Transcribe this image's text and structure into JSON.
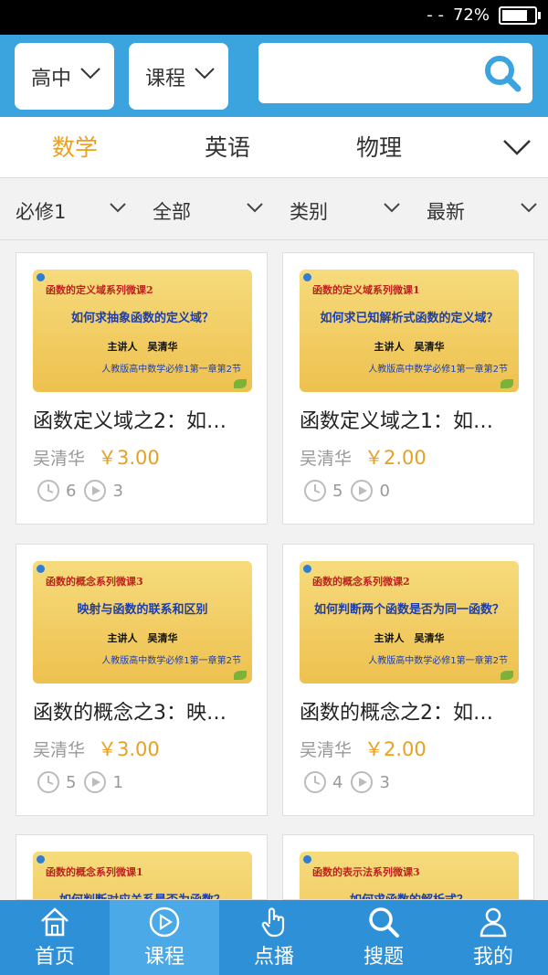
{
  "status_bar": {
    "signal": "- -",
    "battery_text": "72%",
    "battery_level": 0.72
  },
  "header": {
    "level_select": "高中",
    "type_select": "课程",
    "search": {
      "value": "",
      "placeholder": ""
    },
    "accent_color": "#3ba3dd"
  },
  "subjects": {
    "items": [
      "数学",
      "英语",
      "物理"
    ],
    "active": "数学"
  },
  "filters": [
    "必修1",
    "全部",
    "类别",
    "最新"
  ],
  "courses": [
    {
      "series": "函数的定义域系列微课2",
      "title": "如何求抽象函数的定义域？",
      "lecturer": "主讲人　吴清华",
      "book": "人教版高中数学必修1第一章第2节",
      "name": "函数定义域之2：如…",
      "author": "吴清华",
      "price": "￥3.00",
      "duration": "6",
      "plays": "3"
    },
    {
      "series": "函数的定义域系列微课1",
      "title": "如何求已知解析式函数的定义域？",
      "lecturer": "主讲人　吴清华",
      "book": "人教版高中数学必修1第一章第2节",
      "name": "函数定义域之1：如…",
      "author": "吴清华",
      "price": "￥2.00",
      "duration": "5",
      "plays": "0"
    },
    {
      "series": "函数的概念系列微课3",
      "title": "映射与函数的联系和区别",
      "lecturer": "主讲人　吴清华",
      "book": "人教版高中数学必修1第一章第2节",
      "name": "函数的概念之3：映…",
      "author": "吴清华",
      "price": "￥3.00",
      "duration": "5",
      "plays": "1"
    },
    {
      "series": "函数的概念系列微课2",
      "title": "如何判断两个函数是否为同一函数？",
      "lecturer": "主讲人　吴清华",
      "book": "人教版高中数学必修1第一章第2节",
      "name": "函数的概念之2：如…",
      "author": "吴清华",
      "price": "￥2.00",
      "duration": "4",
      "plays": "3"
    },
    {
      "series": "函数的概念系列微课1",
      "title": "如何判断对应关系是否为函数？",
      "lecturer": "",
      "book": "",
      "name": "",
      "author": "",
      "price": "",
      "duration": "",
      "plays": ""
    },
    {
      "series": "函数的表示法系列微课3",
      "title": "如何求函数的解析式？",
      "lecturer": "",
      "book": "",
      "name": "",
      "author": "",
      "price": "",
      "duration": "",
      "plays": ""
    }
  ],
  "tabbar": {
    "items": [
      {
        "label": "首页",
        "icon": "home-icon"
      },
      {
        "label": "课程",
        "icon": "play-circle-icon"
      },
      {
        "label": "点播",
        "icon": "hand-pointer-icon"
      },
      {
        "label": "搜题",
        "icon": "search-icon"
      },
      {
        "label": "我的",
        "icon": "user-icon"
      }
    ],
    "active": "课程"
  }
}
